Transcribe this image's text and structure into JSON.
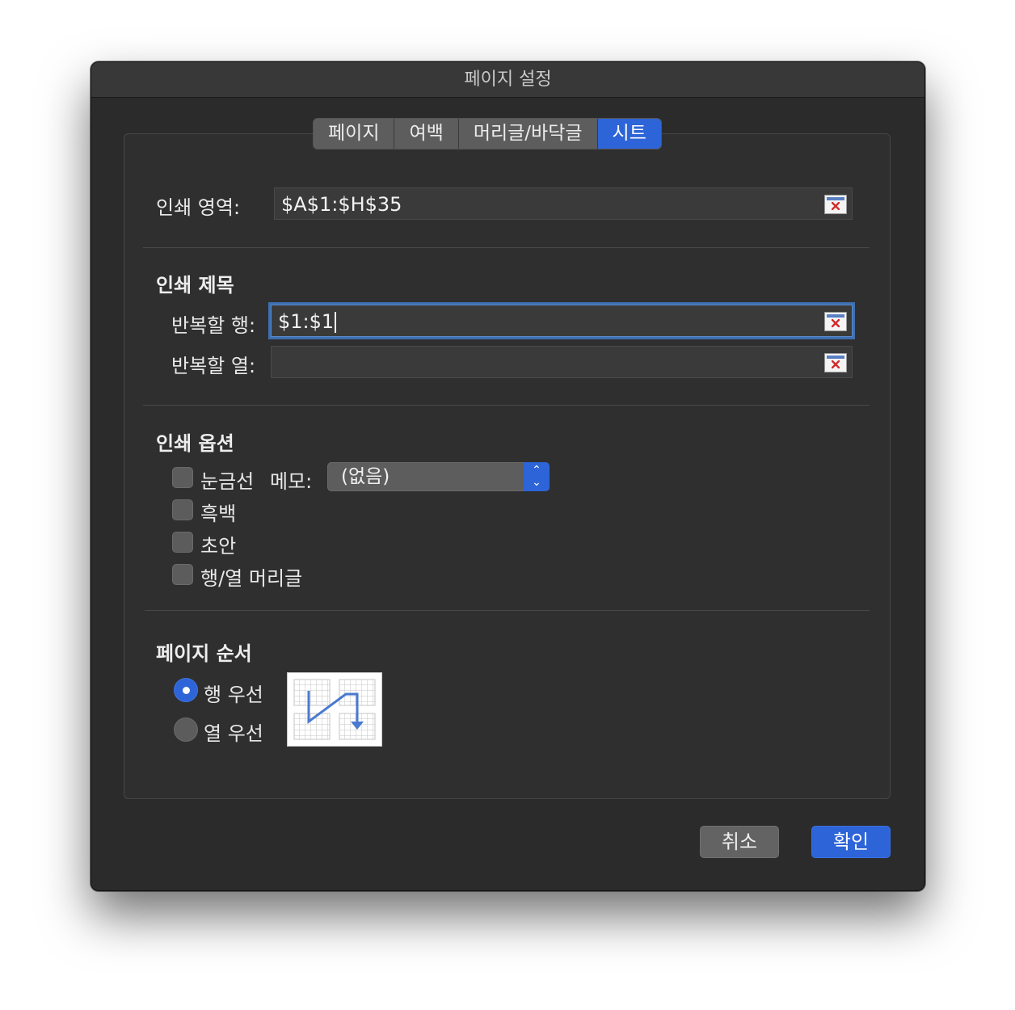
{
  "window": {
    "title": "페이지 설정"
  },
  "tabs": [
    {
      "label": "페이지"
    },
    {
      "label": "여백"
    },
    {
      "label": "머리글/바닥글"
    },
    {
      "label": "시트",
      "active": true
    }
  ],
  "print_area": {
    "label": "인쇄 영역:",
    "value": "$A$1:$H$35"
  },
  "print_titles": {
    "heading": "인쇄 제목",
    "rows_label": "반복할 행:",
    "rows_value": "$1:$1",
    "cols_label": "반복할 열:",
    "cols_value": ""
  },
  "print_options": {
    "heading": "인쇄 옵션",
    "gridlines": "눈금선",
    "memo_label": "메모:",
    "memo_value": "(없음)",
    "black_white": "흑백",
    "draft": "초안",
    "row_col_headers": "행/열 머리글"
  },
  "page_order": {
    "heading": "페이지 순서",
    "row_first": "행 우선",
    "col_first": "열 우선",
    "selected": "row_first"
  },
  "buttons": {
    "cancel": "취소",
    "ok": "확인"
  },
  "colors": {
    "accent": "#2d64d8",
    "window_bg": "#2b2b2b",
    "panel_bg": "#2f2f2f"
  }
}
